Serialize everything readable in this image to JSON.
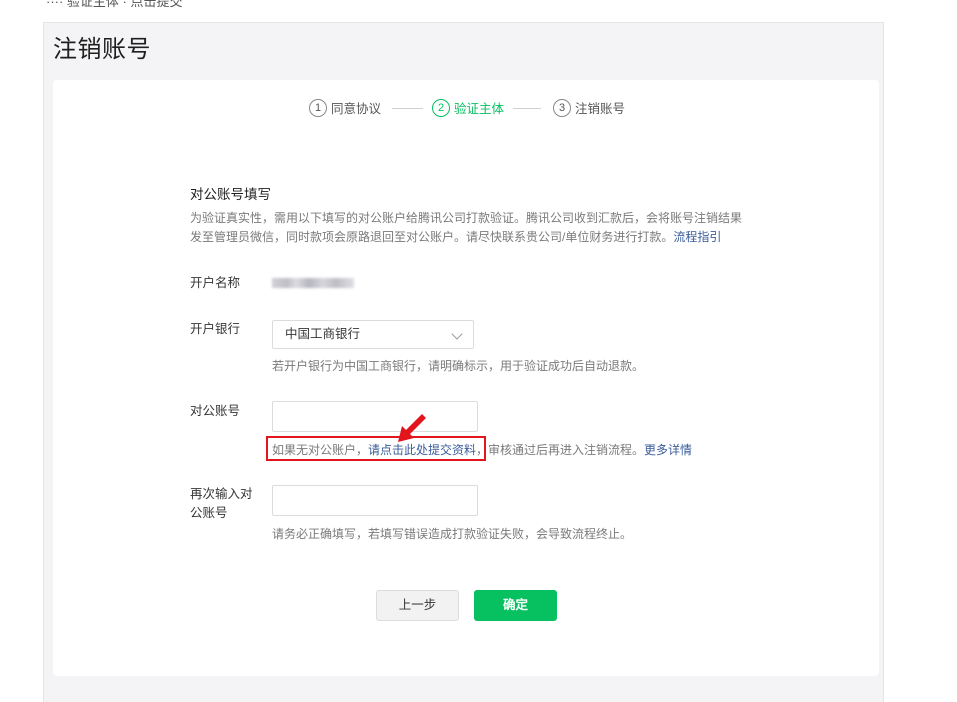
{
  "top_crop_text": "···· 验证主体 · 点击提交",
  "page_title": "注销账号",
  "steps": [
    {
      "num": "1",
      "label": "同意协议",
      "state": "done"
    },
    {
      "num": "2",
      "label": "验证主体",
      "state": "active"
    },
    {
      "num": "3",
      "label": "注销账号",
      "state": "pending"
    }
  ],
  "form": {
    "section_title": "对公账号填写",
    "description": "为验证真实性，需用以下填写的对公账户给腾讯公司打款验证。腾讯公司收到汇款后，会将账号注销结果发至管理员微信，同时款项会原路退回至对公账户。请尽快联系贵公司/单位财务进行打款。",
    "description_link": "流程指引",
    "account_name_label": "开户名称",
    "bank_label": "开户银行",
    "bank_value": "中国工商银行",
    "bank_hint": "若开户银行为中国工商银行，请明确标示，用于验证成功后自动退款。",
    "account_label": "对公账号",
    "account_value": "",
    "no_account_hint_prefix": "如果无对公账户，",
    "no_account_hint_link": "请点击此处提交资料",
    "no_account_hint_suffix": "，审核通过后再进入注销流程。",
    "more_link": "更多详情",
    "confirm_account_label_line1": "再次输入对",
    "confirm_account_label_line2": "公账号",
    "confirm_account_value": "",
    "confirm_hint": "请务必正确填写，若填写错误造成打款验证失败，会导致流程终止。"
  },
  "buttons": {
    "prev": "上一步",
    "ok": "确定"
  },
  "colors": {
    "accent_green": "#07c160",
    "link_blue": "#3a5c9a",
    "annotation_red": "#e2141c"
  },
  "icons": {
    "select_caret": "chevron-down-icon",
    "annotation": "red-arrow-icon"
  }
}
